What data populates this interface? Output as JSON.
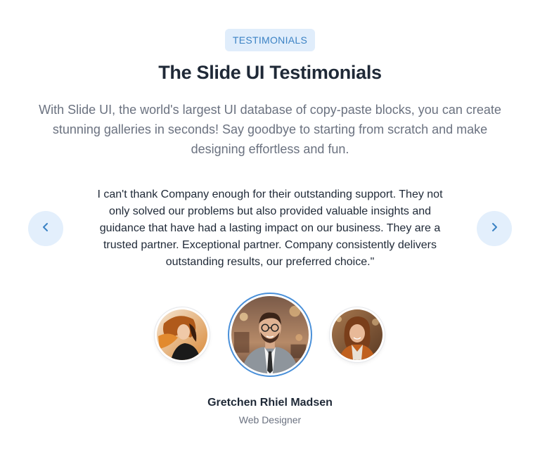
{
  "badge": {
    "label": "TESTIMONIALS"
  },
  "heading": {
    "title": "The Slide UI Testimonials"
  },
  "intro": {
    "text": "With Slide UI, the world's largest UI database of copy-paste blocks, you can create stunning galleries in seconds! Say goodbye to starting from scratch and make designing effortless and fun."
  },
  "testimonial": {
    "quote": "I can't thank Company enough for their outstanding support. They not only solved our problems but also provided valuable insights and guidance that have had a lasting impact on our business. They are a trusted partner. Exceptional partner. Company consistently delivers outstanding results, our preferred choice.\"",
    "name": "Gretchen Rhiel Madsen",
    "role": "Web Designer"
  },
  "navigation": {
    "prev_icon": "chevron-left-icon",
    "next_icon": "chevron-right-icon"
  },
  "colors": {
    "accent": "#3b82c4",
    "badge_bg": "#e0edfb",
    "nav_bg": "#e3effc",
    "active_ring": "#4a90d9"
  }
}
